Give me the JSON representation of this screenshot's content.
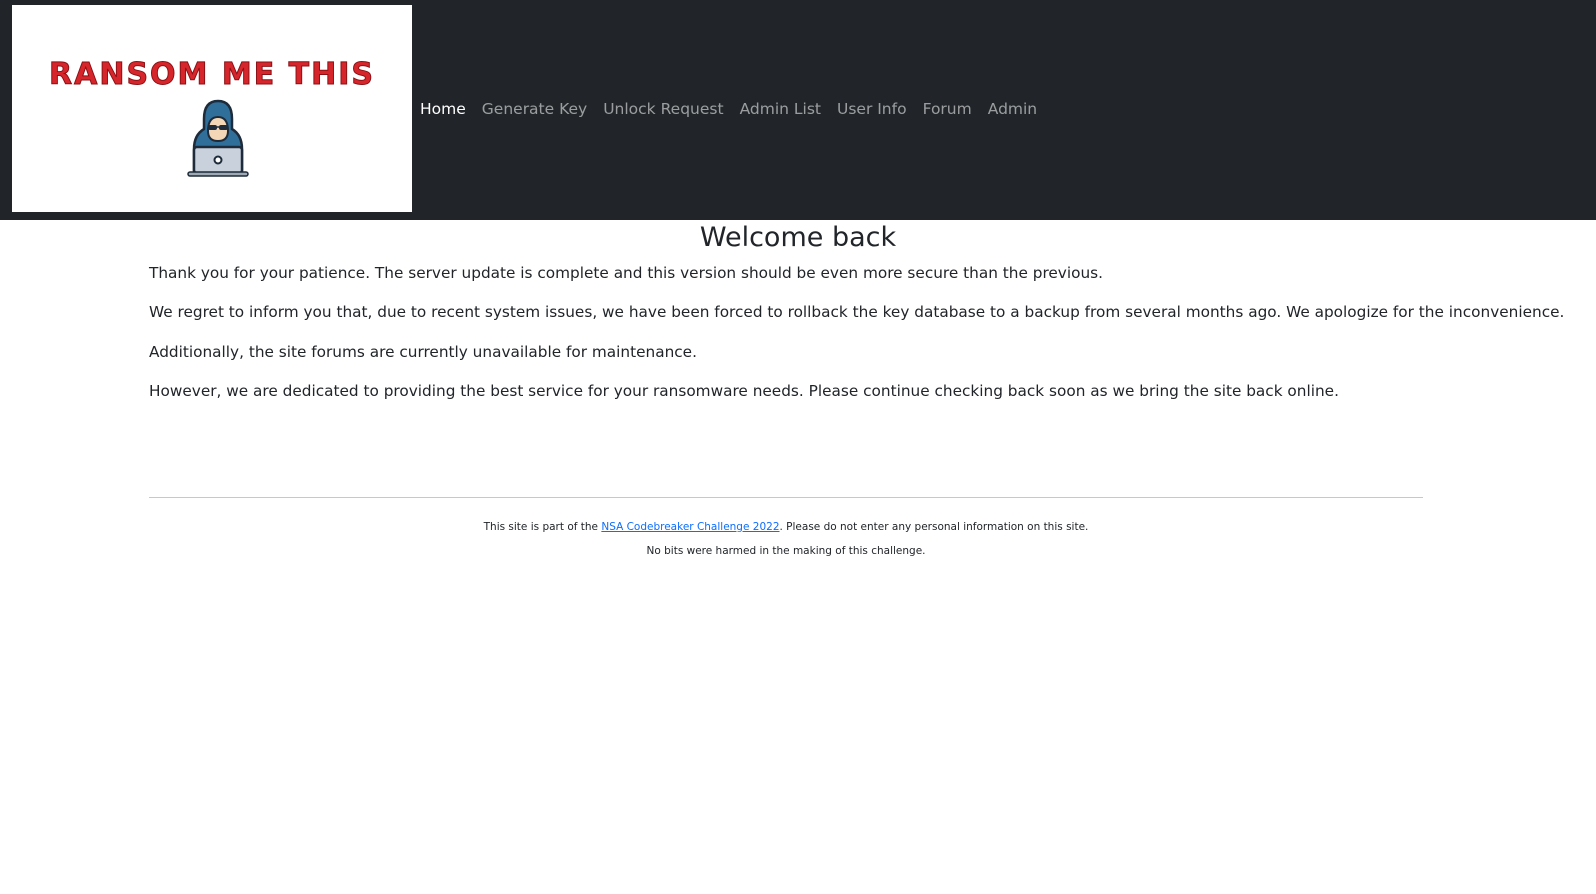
{
  "brand": {
    "logo_text": "RANSOM ME THIS"
  },
  "nav": {
    "items": [
      {
        "label": "Home",
        "active": true
      },
      {
        "label": "Generate Key",
        "active": false
      },
      {
        "label": "Unlock Request",
        "active": false
      },
      {
        "label": "Admin List",
        "active": false
      },
      {
        "label": "User Info",
        "active": false
      },
      {
        "label": "Forum",
        "active": false
      },
      {
        "label": "Admin",
        "active": false
      }
    ]
  },
  "main": {
    "title": "Welcome back",
    "paragraphs": [
      "Thank you for your patience. The server update is complete and this version should be even more secure than the previous.",
      "We regret to inform you that, due to recent system issues, we have been forced to rollback the key database to a backup from several months ago. We apologize for the inconvenience.",
      "Additionally, the site forums are currently unavailable for maintenance.",
      "However, we are dedicated to providing the best service for your ransomware needs. Please continue checking back soon as we bring the site back online."
    ]
  },
  "footer": {
    "line1_prefix": "This site is part of the ",
    "line1_link": "NSA Codebreaker Challenge 2022",
    "line1_suffix": ". Please do not enter any personal information on this site.",
    "line2": "No bits were harmed in the making of this challenge."
  },
  "colors": {
    "navbar_bg": "#212529",
    "logo_red": "#d7262b",
    "link_blue": "#0d6efd"
  }
}
